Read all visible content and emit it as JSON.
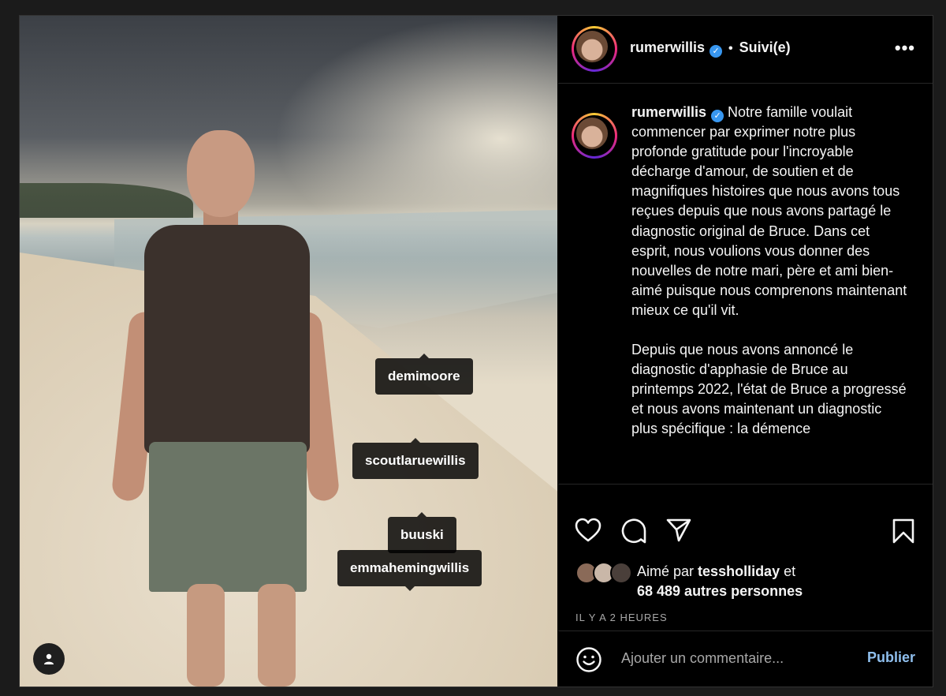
{
  "post": {
    "username": "rumerwillis",
    "follow_status": "Suivi(e)",
    "separator": "•",
    "verified_glyph": "✓",
    "more_label": "•••",
    "caption_paragraphs": [
      "Notre famille voulait commencer par exprimer notre plus profonde gratitude pour l'incroyable décharge d'amour, de soutien et de magnifiques histoires que nous avons tous reçues depuis que nous avons partagé le diagnostic original de Bruce. Dans cet esprit, nous voulions vous donner des nouvelles de notre mari, père et ami bien-aimé puisque nous comprenons maintenant mieux ce qu'il vit.",
      "Depuis que nous avons annoncé le diagnostic d'apphasie de Bruce au printemps 2022, l'état de Bruce a progressé et nous avons maintenant un diagnostic plus spécifique : la démence"
    ]
  },
  "photo_tags": [
    {
      "label": "demimoore"
    },
    {
      "label": "scoutlaruewillis"
    },
    {
      "label": "buuski"
    },
    {
      "label": "emmahemingwillis"
    }
  ],
  "likes": {
    "prefix": "Aimé par",
    "user": "tessholliday",
    "conjunction": "et",
    "others": "68 489 autres personnes"
  },
  "timestamp": "IL Y A 2 HEURES",
  "comment_box": {
    "placeholder": "Ajouter un commentaire...",
    "publish_label": "Publier"
  },
  "icons": {
    "like": "heart-icon",
    "comment": "comment-bubble-icon",
    "share": "paper-plane-icon",
    "save": "bookmark-icon",
    "emoji": "smiley-icon",
    "tagged_users": "user-icon"
  },
  "colors": {
    "verified": "#3897f0",
    "publish": "#8fbfee",
    "muted_text": "#a8a8a8"
  }
}
